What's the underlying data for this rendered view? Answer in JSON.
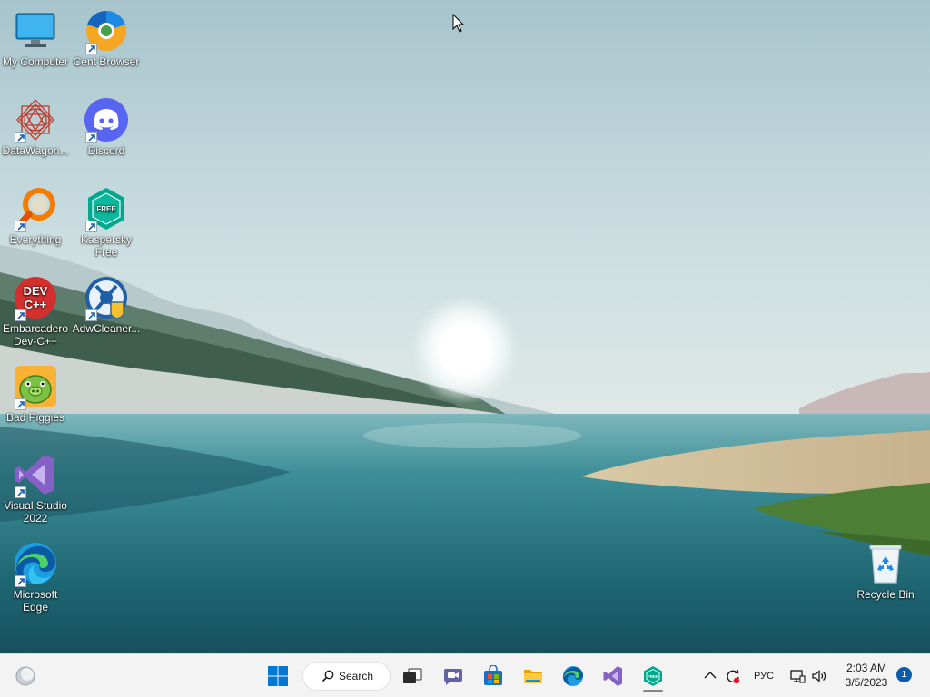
{
  "desktop": {
    "icons": [
      {
        "label": "My Computer",
        "icon": "computer-icon"
      },
      {
        "label": "Cent Browser",
        "icon": "cent-browser-icon"
      },
      {
        "label": "DataWagon...",
        "icon": "datawagon-icon"
      },
      {
        "label": "Discord",
        "icon": "discord-icon"
      },
      {
        "label": "Everything",
        "icon": "everything-search-icon"
      },
      {
        "label": "Kaspersky\nFree",
        "icon": "kaspersky-icon"
      },
      {
        "label": "Embarcadero\nDev-C++",
        "icon": "devcpp-icon"
      },
      {
        "label": "AdwCleaner...",
        "icon": "adwcleaner-icon"
      },
      {
        "label": "Bad Piggies",
        "icon": "bad-piggies-icon"
      },
      {
        "label": "Visual Studio\n2022",
        "icon": "visual-studio-icon"
      },
      {
        "label": "Microsoft\nEdge",
        "icon": "edge-icon"
      },
      {
        "label": "Recycle Bin",
        "icon": "recycle-bin-icon"
      }
    ]
  },
  "taskbar": {
    "search_label": "Search",
    "apps": [
      "widgets-icon",
      "start-icon",
      "task-view-icon",
      "chat-icon",
      "store-icon",
      "file-explorer-icon",
      "edge-icon",
      "visual-studio-icon",
      "kaspersky-icon"
    ],
    "running_app": "Kaspersky Free",
    "tray": {
      "language": "РУС",
      "time": "2:03 AM",
      "date": "3/5/2023",
      "notification_count": "1"
    }
  },
  "colors": {
    "taskbar_bg": "#f3f3f3",
    "accent": "#0b5cab",
    "sky_top": "#a9c7cf",
    "water": "#2b7d88"
  }
}
